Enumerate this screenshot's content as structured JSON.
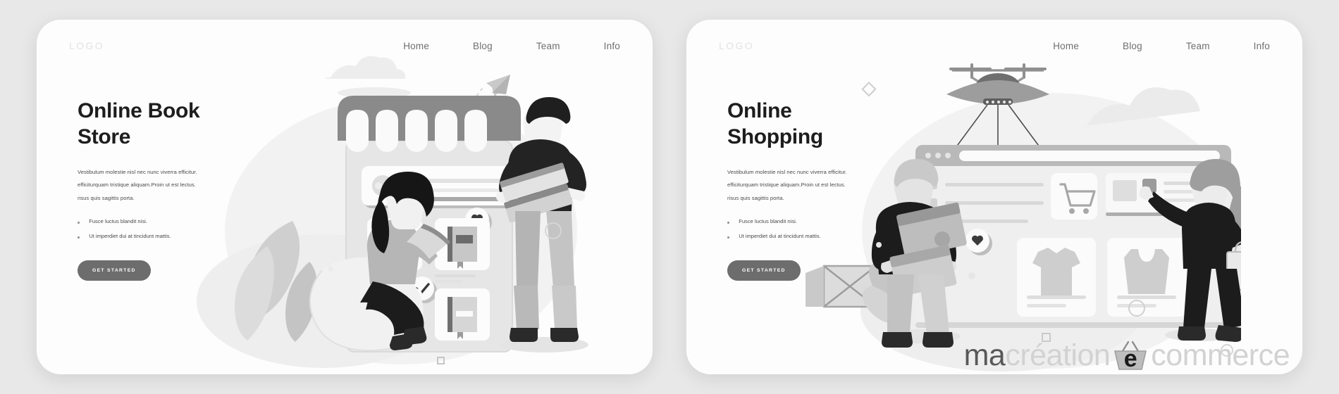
{
  "watermark": {
    "part1": "ma",
    "part2": "création",
    "letter": "e",
    "part3": "commerce",
    "basket_icon": "shopping-basket-icon"
  },
  "colors": {
    "page_background": "#e8e8e8",
    "card_background": "#fdfdfd",
    "heading": "#1d1d1d",
    "body_text": "#4a4a4a",
    "nav_text": "#6f6f6f",
    "logo_text": "#e2e2e2",
    "button_background": "#6d6d6d",
    "button_text": "#ffffff",
    "watermark_dark": "#595959",
    "watermark_light": "#d2d2d2",
    "illustration_dark": "#2b2b2b",
    "illustration_mid": "#9a9a9a",
    "illustration_light": "#d9d9d9"
  },
  "cards": [
    {
      "id": "online-book-store",
      "logo": "LOGO",
      "nav": [
        {
          "label": "Home"
        },
        {
          "label": "Blog"
        },
        {
          "label": "Team"
        },
        {
          "label": "Info"
        }
      ],
      "heading_line1": "Online Book",
      "heading_line2": "Store",
      "paragraph": [
        "Vestibulum molestie nisl nec nunc viverra efficitur.",
        "efficiturquam tristique aliquam.Proin ut est lectus.",
        "risus quis sagittis porta."
      ],
      "bullets": [
        "Fusce luctus blandit nisi.",
        "Ut imperdiet dui at tincidunt mattis."
      ],
      "cta": "GET STARTED",
      "illustration": {
        "name": "online-book-store-illustration",
        "elements": [
          "storefront-phone-awning",
          "book-product-card",
          "heart-icon",
          "check-icon",
          "paper-plane-icon",
          "woman-reading-book",
          "man-holding-books",
          "leaf-plant",
          "cloud-shape"
        ]
      }
    },
    {
      "id": "online-shopping",
      "logo": "LOGO",
      "nav": [
        {
          "label": "Home"
        },
        {
          "label": "Blog"
        },
        {
          "label": "Team"
        },
        {
          "label": "Info"
        }
      ],
      "heading_line1": "Online",
      "heading_line2": "Shopping",
      "paragraph": [
        "Vestibulum molestie nisl nec nunc viverra efficitur.",
        "efficiturquam tristique aliquam.Proin ut est lectus.",
        "risus quis sagittis porta."
      ],
      "bullets": [
        "Fusce luctus blandit nisi.",
        "Ut imperdiet dui at tincidunt mattis."
      ],
      "cta": "GET STARTED",
      "illustration": {
        "name": "online-shopping-illustration",
        "elements": [
          "delivery-drone",
          "browser-window",
          "shopping-cart-icon",
          "tshirt-product-card",
          "tanktop-product-card",
          "heart-icon",
          "man-carrying-boxes",
          "woman-with-shopping-bag",
          "cardboard-box",
          "leaf-plant",
          "cloud-shape"
        ]
      }
    }
  ]
}
